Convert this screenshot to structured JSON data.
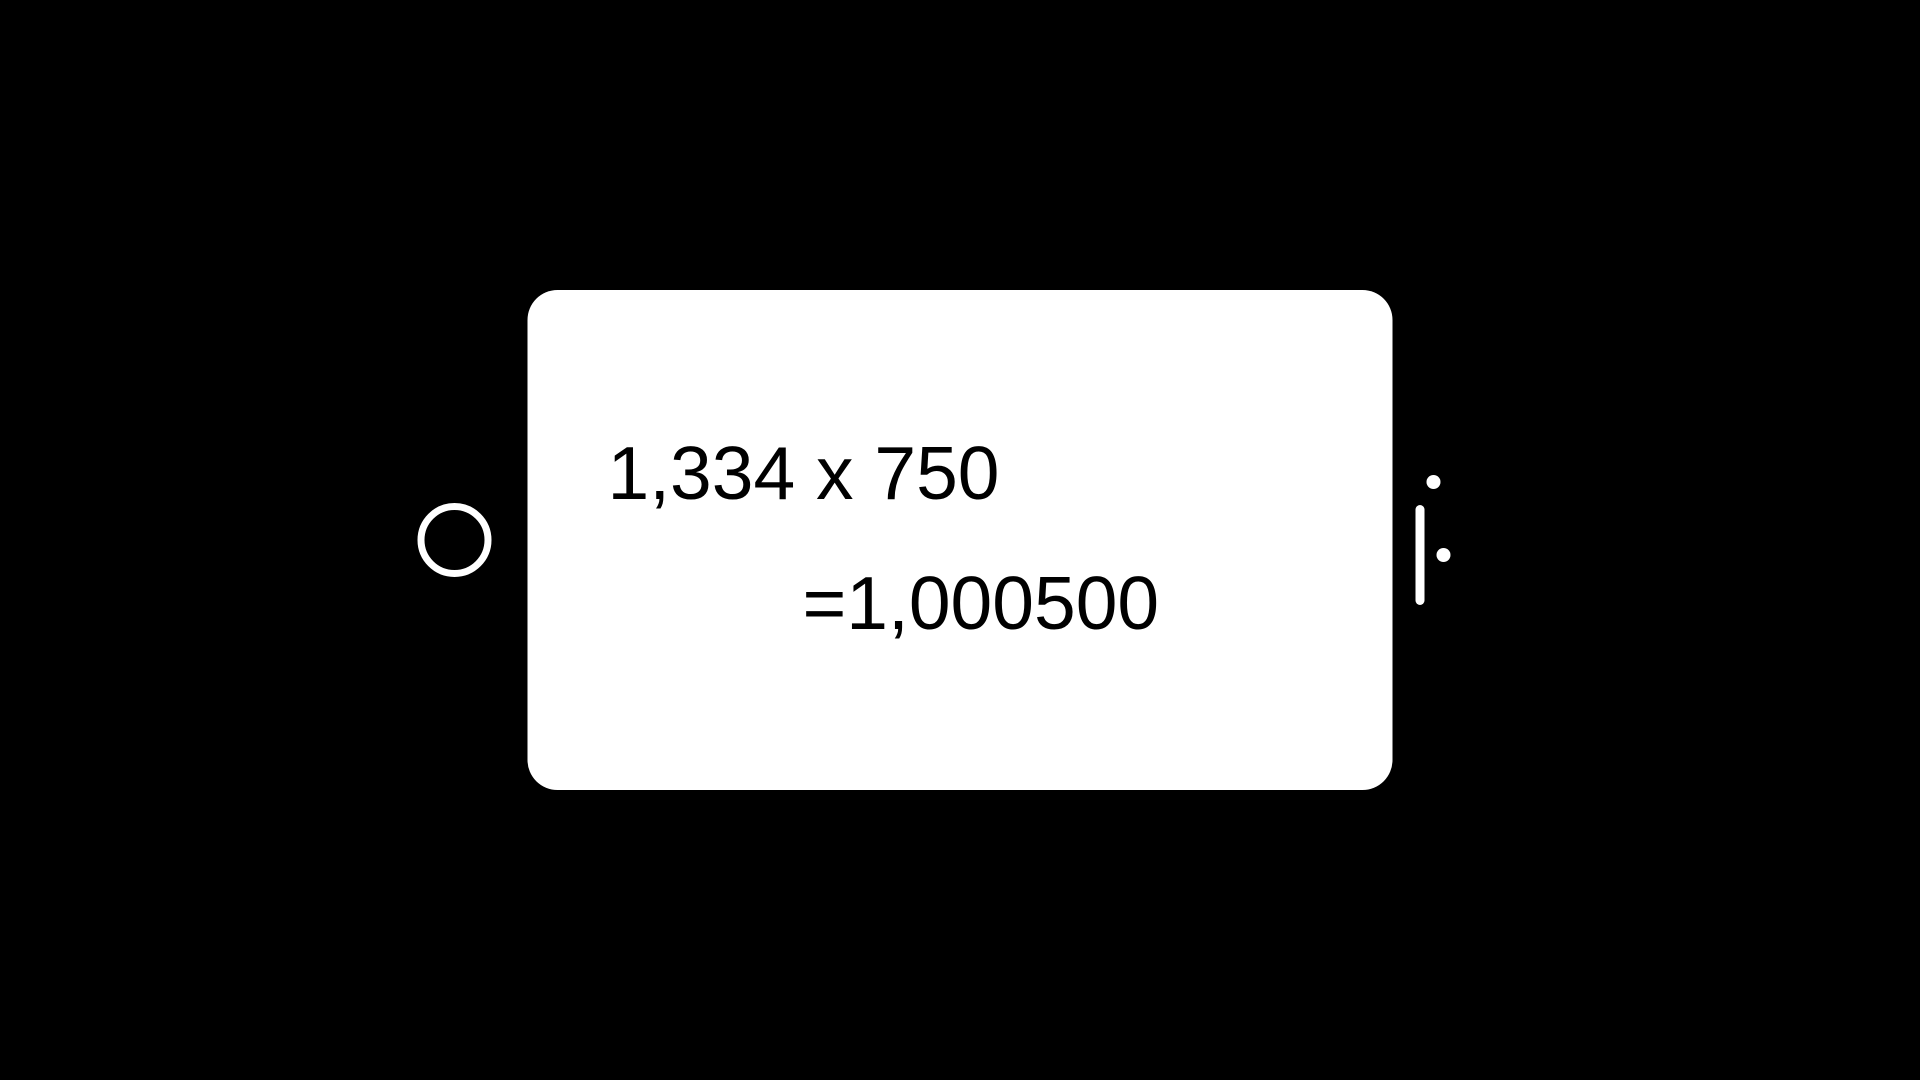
{
  "device": {
    "screen": {
      "line1": "1,334 x 750",
      "line2": "=1,000500"
    }
  }
}
